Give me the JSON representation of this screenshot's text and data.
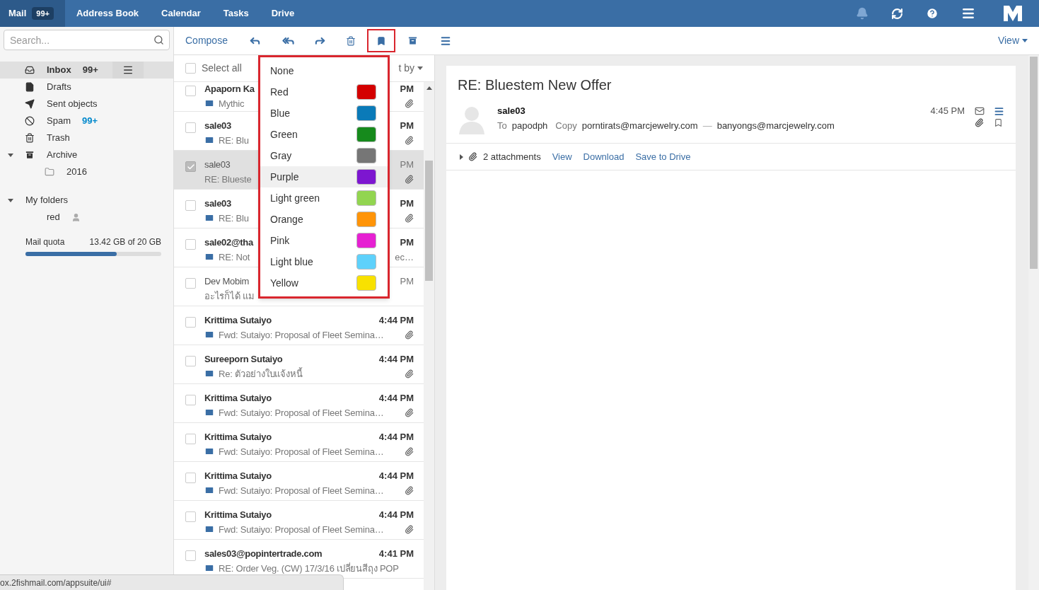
{
  "top_nav": {
    "tabs": [
      {
        "label": "Mail",
        "badge": "99+",
        "selected": true
      },
      {
        "label": "Address Book",
        "selected": false
      },
      {
        "label": "Calendar",
        "selected": false
      },
      {
        "label": "Tasks",
        "selected": false
      },
      {
        "label": "Drive",
        "selected": false
      }
    ]
  },
  "sidebar": {
    "search": {
      "placeholder": "Search..."
    },
    "folders": [
      {
        "kind": "inbox",
        "label": "Inbox",
        "count": "99+",
        "selected": true
      },
      {
        "kind": "drafts",
        "label": "Drafts",
        "selected": false
      },
      {
        "kind": "sent",
        "label": "Sent objects",
        "selected": false
      },
      {
        "kind": "spam",
        "label": "Spam",
        "count": "99+",
        "selected": false
      },
      {
        "kind": "trash",
        "label": "Trash",
        "selected": false
      },
      {
        "kind": "archive",
        "label": "Archive",
        "selected": false,
        "expanded": true,
        "children": [
          {
            "kind": "folder",
            "label": "2016",
            "selected": false
          }
        ]
      }
    ],
    "my_folders": {
      "label": "My folders",
      "expanded": true,
      "children": [
        {
          "kind": "shared",
          "label": "red",
          "selected": false
        }
      ]
    },
    "quota": {
      "label": "Mail quota",
      "reading": "13.42 GB of 20 GB",
      "level": 0.67
    }
  },
  "toolbar": {
    "compose": "Compose",
    "flag_active": true,
    "view": "View"
  },
  "list": {
    "select_all": {
      "label": "Select all",
      "checked": false
    },
    "sort_label": "t by",
    "rows": [
      {
        "sender": "Apaporn Ka",
        "subject": "Mythic",
        "time": "PM",
        "unread": true,
        "checked": false,
        "selected": false,
        "attachment": true,
        "icon": true
      },
      {
        "sender": "sale03",
        "subject": "RE: Blu",
        "time": "PM",
        "unread": true,
        "checked": false,
        "selected": false,
        "attachment": true,
        "icon": true
      },
      {
        "sender": "sale03",
        "subject": "RE: Blueste",
        "time": "PM",
        "unread": false,
        "checked": true,
        "selected": true,
        "attachment": true,
        "icon": false
      },
      {
        "sender": "sale03",
        "subject": "RE: Blu",
        "time": "PM",
        "unread": true,
        "checked": false,
        "selected": false,
        "attachment": true,
        "icon": true
      },
      {
        "sender": "sale02@tha",
        "subject": "RE: Not",
        "subject_tail": "ec…",
        "time": "PM",
        "unread": true,
        "checked": false,
        "selected": false,
        "attachment": false,
        "icon": true
      },
      {
        "sender": "Dev Mobim",
        "subject": "อะไรก็ได้ แม",
        "time": "PM",
        "unread": false,
        "checked": false,
        "selected": false,
        "attachment": false,
        "icon": false
      },
      {
        "sender": "Krittima Sutaiyo",
        "subject": "Fwd: Sutaiyo: Proposal of Fleet Semina…",
        "time": "4:44 PM",
        "unread": true,
        "checked": false,
        "selected": false,
        "attachment": true,
        "icon": true
      },
      {
        "sender": "Sureeporn Sutaiyo",
        "subject": "Re: ตัวอย่างใบแจ้งหนี้",
        "time": "4:44 PM",
        "unread": true,
        "checked": false,
        "selected": false,
        "attachment": true,
        "icon": true
      },
      {
        "sender": "Krittima Sutaiyo",
        "subject": "Fwd: Sutaiyo: Proposal of Fleet Semina…",
        "time": "4:44 PM",
        "unread": true,
        "checked": false,
        "selected": false,
        "attachment": true,
        "icon": true
      },
      {
        "sender": "Krittima Sutaiyo",
        "subject": "Fwd: Sutaiyo: Proposal of Fleet Semina…",
        "time": "4:44 PM",
        "unread": true,
        "checked": false,
        "selected": false,
        "attachment": true,
        "icon": true
      },
      {
        "sender": "Krittima Sutaiyo",
        "subject": "Fwd: Sutaiyo: Proposal of Fleet Semina…",
        "time": "4:44 PM",
        "unread": true,
        "checked": false,
        "selected": false,
        "attachment": true,
        "icon": true
      },
      {
        "sender": "Krittima Sutaiyo",
        "subject": "Fwd: Sutaiyo: Proposal of Fleet Semina…",
        "time": "4:44 PM",
        "unread": true,
        "checked": false,
        "selected": false,
        "attachment": true,
        "icon": true
      },
      {
        "sender": "sales03@popintertrade.com",
        "subject": "RE: Order Veg. (CW) 17/3/16 เปลี่ยนสีถุง POP",
        "time": "4:41 PM",
        "unread": true,
        "checked": false,
        "selected": false,
        "attachment": false,
        "icon": true
      }
    ]
  },
  "flag_menu": {
    "items": [
      {
        "label": "None",
        "selected": false
      },
      {
        "label": "Red",
        "color": "#d40000",
        "selected": false
      },
      {
        "label": "Blue",
        "color": "#0a7ab8",
        "selected": false
      },
      {
        "label": "Green",
        "color": "#168a1c",
        "selected": false
      },
      {
        "label": "Gray",
        "color": "#767676",
        "selected": false
      },
      {
        "label": "Purple",
        "color": "#7d16d0",
        "selected": true
      },
      {
        "label": "Light green",
        "color": "#92d550",
        "selected": false
      },
      {
        "label": "Orange",
        "color": "#ff9408",
        "selected": false
      },
      {
        "label": "Pink",
        "color": "#e620d2",
        "selected": false
      },
      {
        "label": "Light blue",
        "color": "#5ed1fb",
        "selected": false
      },
      {
        "label": "Yellow",
        "color": "#f8e100",
        "selected": false
      }
    ]
  },
  "reader": {
    "subject": "RE: Bluestem New Offer",
    "sender": "sale03",
    "to_label": "To",
    "to": "papodph",
    "copy_label": "Copy",
    "copy": [
      "porntirats@marcjewelry.com",
      "banyongs@marcjewelry.com"
    ],
    "separator": "—",
    "time": "4:45 PM",
    "attachments": {
      "expanded": false,
      "label": "2 attachments",
      "actions": [
        "View",
        "Download",
        "Save to Drive"
      ]
    }
  },
  "status_bar": {
    "url": "ox.2fishmail.com/appsuite/ui#"
  }
}
